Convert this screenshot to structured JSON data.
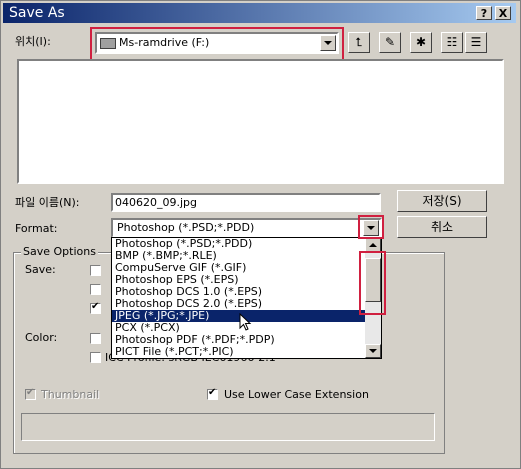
{
  "window": {
    "title": "Save As",
    "help_label": "?",
    "close_label": "X"
  },
  "location": {
    "label": "위치(I):",
    "value": "Ms-ramdrive (F:)"
  },
  "toolbar": {
    "up_icon": "folder-up-icon",
    "newfolder_icon": "new-folder-icon",
    "desktop_icon": "desktop-icon",
    "list_icon": "list-view-icon",
    "details_icon": "details-view-icon"
  },
  "filename": {
    "label": "파일 이름(N):",
    "value": "040620_09.jpg"
  },
  "format": {
    "label": "Format:",
    "value": "Photoshop (*.PSD;*.PDD)",
    "options": [
      "Photoshop (*.PSD;*.PDD)",
      "BMP (*.BMP;*.RLE)",
      "CompuServe GIF (*.GIF)",
      "Photoshop EPS (*.EPS)",
      "Photoshop DCS 1.0 (*.EPS)",
      "Photoshop DCS 2.0 (*.EPS)",
      "JPEG (*.JPG;*.JPE)",
      "PCX (*.PCX)",
      "Photoshop PDF (*.PDF;*.PDP)",
      "PICT File (*.PCT;*.PIC)"
    ],
    "selected_index": 6
  },
  "buttons": {
    "save": "저장(S)",
    "cancel": "취소"
  },
  "save_options": {
    "group_label": "Save Options",
    "save_label": "Save:",
    "color_label": "Color:",
    "obscured_text": "ICC Profile: sRGB IEC61966-2.1",
    "thumbnail_label": "Thumbnail",
    "lowercase_label": "Use Lower Case Extension"
  }
}
